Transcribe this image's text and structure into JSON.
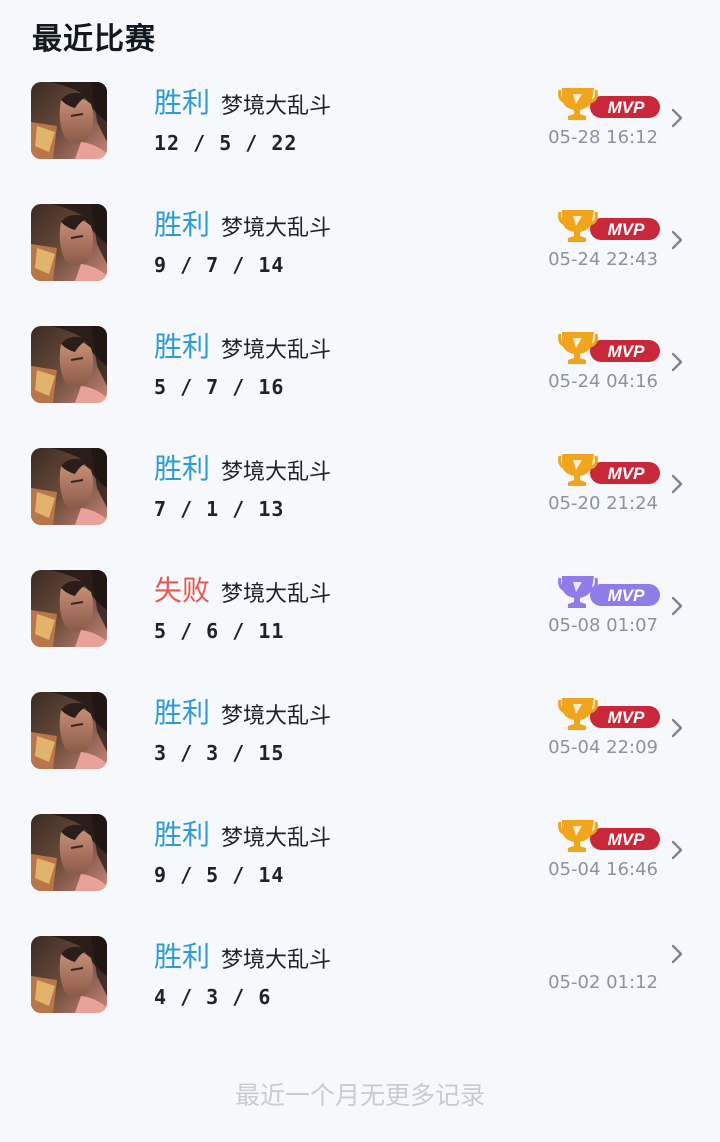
{
  "section": {
    "title": "最近比赛"
  },
  "matches": [
    {
      "result": "胜利",
      "win": true,
      "mode": "梦境大乱斗",
      "kda": "12 / 5 / 22",
      "mvp": "gold",
      "time": "05-28 16:12"
    },
    {
      "result": "胜利",
      "win": true,
      "mode": "梦境大乱斗",
      "kda": "9 / 7 / 14",
      "mvp": "gold",
      "time": "05-24 22:43"
    },
    {
      "result": "胜利",
      "win": true,
      "mode": "梦境大乱斗",
      "kda": "5 / 7 / 16",
      "mvp": "gold",
      "time": "05-24 04:16"
    },
    {
      "result": "胜利",
      "win": true,
      "mode": "梦境大乱斗",
      "kda": "7 / 1 / 13",
      "mvp": "gold",
      "time": "05-20 21:24"
    },
    {
      "result": "失败",
      "win": false,
      "mode": "梦境大乱斗",
      "kda": "5 / 6 / 11",
      "mvp": "purple",
      "time": "05-08 01:07"
    },
    {
      "result": "胜利",
      "win": true,
      "mode": "梦境大乱斗",
      "kda": "3 / 3 / 15",
      "mvp": "gold",
      "time": "05-04 22:09"
    },
    {
      "result": "胜利",
      "win": true,
      "mode": "梦境大乱斗",
      "kda": "9 / 5 / 14",
      "mvp": "gold",
      "time": "05-04 16:46"
    },
    {
      "result": "胜利",
      "win": true,
      "mode": "梦境大乱斗",
      "kda": "4 / 3 / 6",
      "mvp": "none",
      "time": "05-02 01:12"
    }
  ],
  "mvp_badge": {
    "label": "MVP"
  },
  "footer": {
    "text": "最近一个月无更多记录"
  },
  "colors": {
    "win": "#2e9bd4",
    "loss": "#e9584f",
    "mvp_gold_trophy": "#f0a51c",
    "mvp_gold_band": "#c8283a",
    "mvp_purple": "#8f7ce8"
  },
  "icons": {
    "avatar": "hero-portrait",
    "badge": "mvp-trophy-icon",
    "arrow": "chevron-right-icon"
  }
}
